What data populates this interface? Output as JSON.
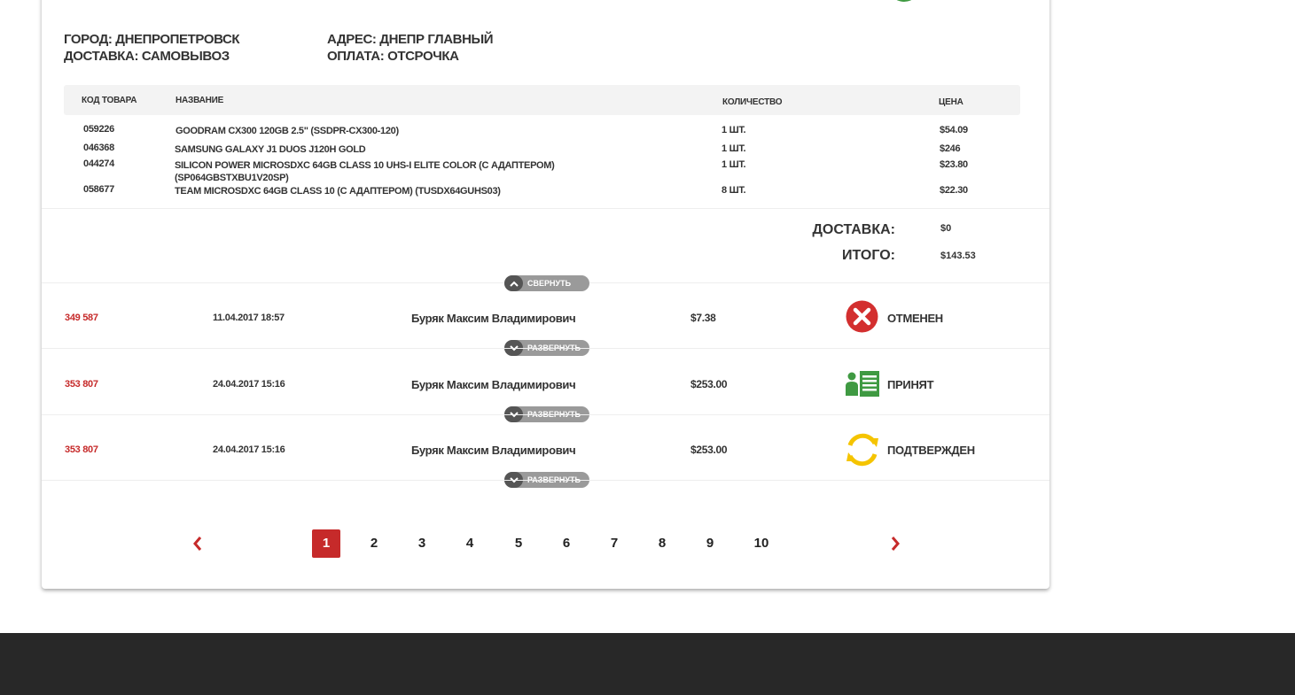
{
  "order_info": {
    "city": "ГОРОД: ДНЕПРОПЕТРОВСК",
    "delivery": "ДОСТАВКА: САМОВЫВОЗ",
    "address": "АДРЕС: ДНЕПР ГЛАВНЫЙ",
    "payment": "ОПЛАТА: ОТСРОЧКА"
  },
  "items_table": {
    "headers": {
      "code": "КОД ТОВАРА",
      "name": "НАЗВАНИЕ",
      "qty": "КОЛИЧЕСТВО",
      "price": "ЦЕНА"
    },
    "rows": [
      {
        "code": "059226",
        "name": "GOODRAM CX300 120GB 2.5\" (SSDPR-CX300-120)",
        "qty": "1 ШТ.",
        "price": "$54.09"
      },
      {
        "code": "046368",
        "name": "SAMSUNG GALAXY J1 DUOS J120H GOLD",
        "qty": "1 ШТ.",
        "price": "$246"
      },
      {
        "code": "044274",
        "name": "SILICON POWER MICROSDXC 64GB CLASS 10 UHS-I ELITE COLOR (С АДАПТЕРОМ) (SP064GBSTXBU1V20SP)",
        "qty": "1 ШТ.",
        "price": "$23.80"
      },
      {
        "code": "058677",
        "name": "TEAM MICROSDXC 64GB CLASS 10 (С АДАПТЕРОМ) (TUSDX64GUHS03)",
        "qty": "8 ШТ.",
        "price": "$22.30"
      }
    ]
  },
  "totals": {
    "delivery_label": "ДОСТАВКА:",
    "delivery_value": "$0",
    "total_label": "ИТОГО:",
    "total_value": "$143.53"
  },
  "toggle": {
    "collapse_label": "СВЕРНУТЬ",
    "expand_label": "РАЗВЕРНУТЬ"
  },
  "orders": [
    {
      "id": "349 587",
      "date": "11.04.2017 18:57",
      "customer": "Буряк Максим Владимирович",
      "sum": "$7.38",
      "status": "ОТМЕНЕН",
      "status_icon": "cancelled-icon",
      "status_color": "#d32f2f"
    },
    {
      "id": "353 807",
      "date": "24.04.2017 15:16",
      "customer": "Буряк Максим Владимирович",
      "sum": "$253.00",
      "status": "ПРИНЯТ",
      "status_icon": "accepted-icon",
      "status_color": "#3f9a42"
    },
    {
      "id": "353 807",
      "date": "24.04.2017 15:16",
      "customer": "Буряк Максим Владимирович",
      "sum": "$253.00",
      "status": "ПОДТВЕРЖДЕН",
      "status_icon": "confirmed-icon",
      "status_color": "#f5c400"
    }
  ],
  "pagination": {
    "pages": [
      "1",
      "2",
      "3",
      "4",
      "5",
      "6",
      "7",
      "8",
      "9",
      "10"
    ],
    "current": "1",
    "accent": "#c62a2a",
    "prev_icon": "chevron-left-icon",
    "next_icon": "chevron-right-icon"
  },
  "colors": {
    "accent": "#c62a2a",
    "footer": "#282828"
  }
}
